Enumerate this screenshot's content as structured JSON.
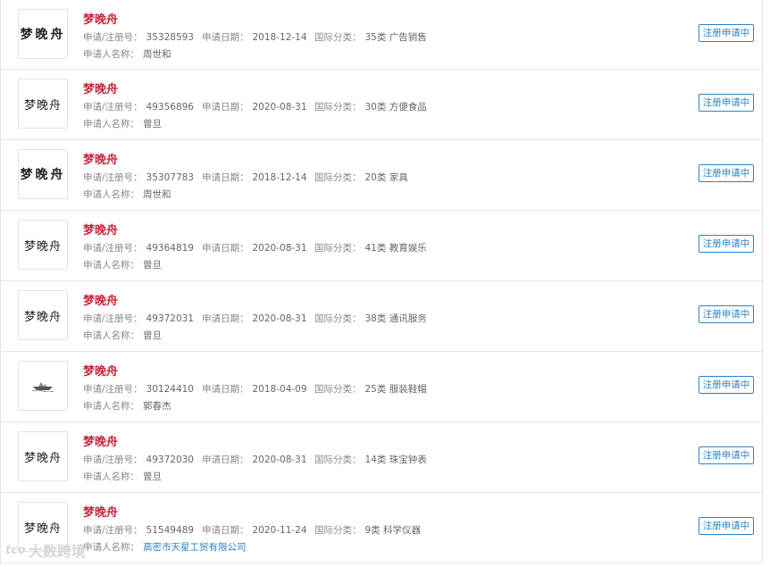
{
  "labels": {
    "reg_no": "申请/注册号：",
    "apply_date": "申请日期：",
    "intl_class": "国际分类：",
    "applicant": "申请人名称："
  },
  "items": [
    {
      "name": "梦晚舟",
      "reg_no": "35328593",
      "date": "2018-12-14",
      "class": "35类 广告销售",
      "applicant": "周世和",
      "status": "注册申请中",
      "thumb_text": "梦晚舟",
      "thumb_style": "bold"
    },
    {
      "name": "梦晚舟",
      "reg_no": "49356896",
      "date": "2020-08-31",
      "class": "30类 方便食品",
      "applicant": "曾旦",
      "status": "注册申请中",
      "thumb_text": "梦晚舟",
      "thumb_style": "plain"
    },
    {
      "name": "梦晚舟",
      "reg_no": "35307783",
      "date": "2018-12-14",
      "class": "20类 家具",
      "applicant": "周世和",
      "status": "注册申请中",
      "thumb_text": "梦晚舟",
      "thumb_style": "bold"
    },
    {
      "name": "梦晚舟",
      "reg_no": "49364819",
      "date": "2020-08-31",
      "class": "41类 教育娱乐",
      "applicant": "曾旦",
      "status": "注册申请中",
      "thumb_text": "梦晚舟",
      "thumb_style": "plain"
    },
    {
      "name": "梦晚舟",
      "reg_no": "49372031",
      "date": "2020-08-31",
      "class": "38类 通讯服务",
      "applicant": "曾旦",
      "status": "注册申请中",
      "thumb_text": "梦晚舟",
      "thumb_style": "plain"
    },
    {
      "name": "梦晚舟",
      "reg_no": "30124410",
      "date": "2018-04-09",
      "class": "25类 服装鞋帽",
      "applicant": "郭春杰",
      "status": "注册申请中",
      "thumb_text": "",
      "thumb_style": "boat"
    },
    {
      "name": "梦晚舟",
      "reg_no": "49372030",
      "date": "2020-08-31",
      "class": "14类 珠宝钟表",
      "applicant": "曾旦",
      "status": "注册申请中",
      "thumb_text": "梦晚舟",
      "thumb_style": "plain"
    },
    {
      "name": "梦晚舟",
      "reg_no": "51549489",
      "date": "2020-11-24",
      "class": "9类 科学仪器",
      "applicant": "高密市天星工贸有限公司",
      "applicant_is_link": true,
      "status": "注册申请中",
      "thumb_text": "梦晚舟",
      "thumb_style": "plain"
    }
  ],
  "watermark": {
    "logo": "tco",
    "text": "大数跨境"
  },
  "colors": {
    "name": "#c8283c",
    "accent": "#2b83c9",
    "border": "#e6e6e6"
  }
}
